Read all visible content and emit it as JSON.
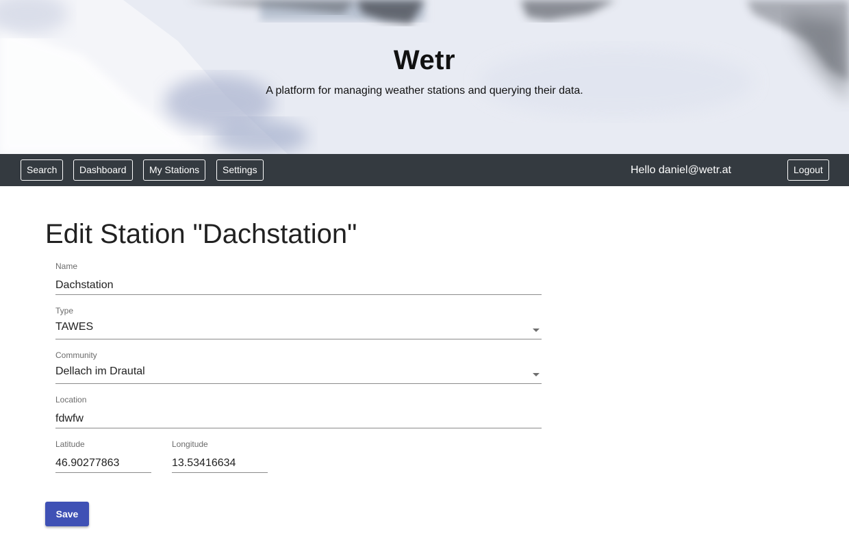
{
  "hero": {
    "title": "Wetr",
    "subtitle": "A platform for managing weather stations and querying their data."
  },
  "nav": {
    "search": "Search",
    "dashboard": "Dashboard",
    "my_stations": "My Stations",
    "settings": "Settings",
    "greeting": "Hello daniel@wetr.at",
    "logout": "Logout"
  },
  "page": {
    "title": "Edit Station \"Dachstation\""
  },
  "form": {
    "name": {
      "label": "Name",
      "value": "Dachstation"
    },
    "type": {
      "label": "Type",
      "value": "TAWES"
    },
    "community": {
      "label": "Community",
      "value": "Dellach im Drautal"
    },
    "location": {
      "label": "Location",
      "value": "fdwfw"
    },
    "latitude": {
      "label": "Latitude",
      "value": "46.90277863"
    },
    "longitude": {
      "label": "Longitude",
      "value": "13.53416634"
    },
    "save_label": "Save"
  },
  "colors": {
    "navbar": "#343a40",
    "primary": "#3f51b5"
  },
  "icons": {
    "dropdown": "caret-down-icon"
  }
}
